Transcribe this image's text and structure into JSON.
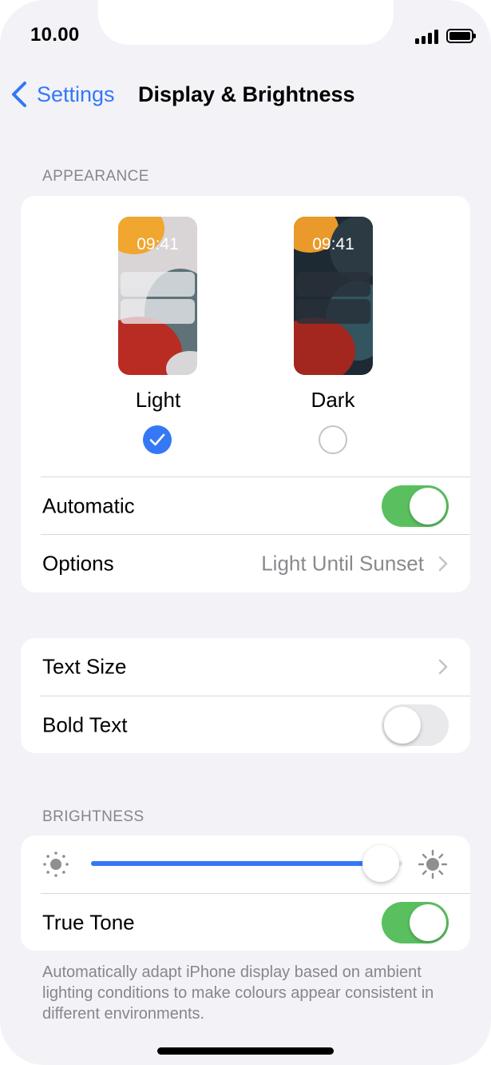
{
  "status_bar": {
    "time": "10.00"
  },
  "nav": {
    "back_label": "Settings",
    "title": "Display & Brightness"
  },
  "appearance": {
    "header": "APPEARANCE",
    "preview_time": "09:41",
    "modes": [
      {
        "label": "Light",
        "selected": true
      },
      {
        "label": "Dark",
        "selected": false
      }
    ],
    "automatic": {
      "label": "Automatic",
      "on": true
    },
    "options": {
      "label": "Options",
      "value": "Light Until Sunset"
    }
  },
  "text": {
    "text_size": {
      "label": "Text Size"
    },
    "bold_text": {
      "label": "Bold Text",
      "on": false
    }
  },
  "brightness": {
    "header": "BRIGHTNESS",
    "level": 0.93,
    "true_tone": {
      "label": "True Tone",
      "on": true
    },
    "footer": "Automatically adapt iPhone display based on ambient lighting conditions to make colours appear consistent in different environments."
  },
  "colors": {
    "accent": "#3478f6",
    "toggle_on": "#5ac05f",
    "background": "#f2f2f7"
  },
  "icons": {
    "back": "chevron-left-icon",
    "chevron": "chevron-right-icon",
    "brightness_low": "sun-small-icon",
    "brightness_high": "sun-large-icon",
    "check": "checkmark-icon"
  }
}
